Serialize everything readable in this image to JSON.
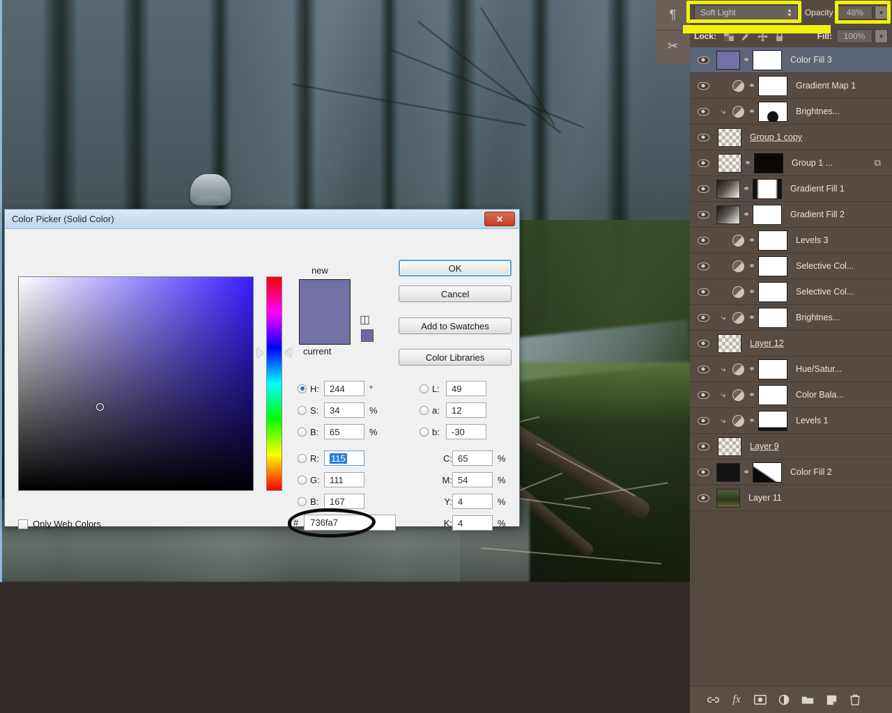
{
  "app": {
    "canvas_alt": "Misty forest scene with light shafts and gravel path"
  },
  "layers_panel": {
    "blend_mode": "Soft Light",
    "opacity_label": "Opacity",
    "opacity_value": "48%",
    "lock_label": "Lock:",
    "fill_label": "Fill:",
    "fill_value": "100%",
    "lock_icons": [
      "transparency-lock-icon",
      "paint-lock-icon",
      "move-lock-icon",
      "all-lock-icon"
    ],
    "strip_icons": [
      "paragraph-panel-icon",
      "tools-panel-icon"
    ],
    "bottom_icons": [
      "link-layers-icon",
      "layer-style-fx-icon",
      "add-mask-icon",
      "adjustment-layer-icon",
      "new-group-icon",
      "new-layer-icon",
      "delete-layer-icon"
    ],
    "bottom_labels": [
      "⚭",
      "fx",
      "▣",
      "◑",
      "▰",
      "⧉",
      "Ὕ1"
    ],
    "layers": [
      {
        "name": "Color Fill 3",
        "type": "fill",
        "selected": true,
        "clipped": false,
        "linked": true,
        "thumb": "solid-purple",
        "mask": "white",
        "badge": ""
      },
      {
        "name": "Gradient Map 1",
        "type": "adjustment",
        "selected": false,
        "clipped": false,
        "linked": true,
        "thumb": "adjustment",
        "mask": "white",
        "badge": ""
      },
      {
        "name": "Brightnes...",
        "type": "adjustment",
        "selected": false,
        "clipped": true,
        "linked": true,
        "thumb": "adjustment",
        "mask": "shape",
        "badge": ""
      },
      {
        "name": "Group 1 copy",
        "type": "pixel",
        "selected": false,
        "clipped": false,
        "linked": false,
        "thumb": "transparent",
        "mask": "none",
        "badge": "",
        "underline": true
      },
      {
        "name": "Group 1 ...",
        "type": "pixel",
        "selected": false,
        "clipped": false,
        "linked": true,
        "thumb": "transparent",
        "mask": "black",
        "badge": "smart-object-icon"
      },
      {
        "name": "Gradient Fill 1",
        "type": "fill",
        "selected": false,
        "clipped": false,
        "linked": true,
        "thumb": "gradient",
        "mask": "trapezoid",
        "badge": ""
      },
      {
        "name": "Gradient Fill 2",
        "type": "fill",
        "selected": false,
        "clipped": false,
        "linked": true,
        "thumb": "gradient",
        "mask": "white",
        "badge": ""
      },
      {
        "name": "Levels 3",
        "type": "adjustment",
        "selected": false,
        "clipped": false,
        "linked": true,
        "thumb": "adjustment",
        "mask": "white",
        "badge": ""
      },
      {
        "name": "Selective Col...",
        "type": "adjustment",
        "selected": false,
        "clipped": false,
        "linked": true,
        "thumb": "adjustment",
        "mask": "white",
        "badge": ""
      },
      {
        "name": "Selective Col...",
        "type": "adjustment",
        "selected": false,
        "clipped": false,
        "linked": true,
        "thumb": "adjustment",
        "mask": "white",
        "badge": ""
      },
      {
        "name": "Brightnes...",
        "type": "adjustment",
        "selected": false,
        "clipped": true,
        "linked": true,
        "thumb": "adjustment",
        "mask": "white",
        "badge": ""
      },
      {
        "name": "Layer 12",
        "type": "pixel",
        "selected": false,
        "clipped": false,
        "linked": false,
        "thumb": "transparent",
        "mask": "none",
        "badge": "",
        "underline": true
      },
      {
        "name": "Hue/Satur...",
        "type": "adjustment",
        "selected": false,
        "clipped": true,
        "linked": true,
        "thumb": "adjustment",
        "mask": "white",
        "badge": ""
      },
      {
        "name": "Color Bala...",
        "type": "adjustment",
        "selected": false,
        "clipped": true,
        "linked": true,
        "thumb": "adjustment",
        "mask": "white",
        "badge": ""
      },
      {
        "name": "Levels 1",
        "type": "adjustment",
        "selected": false,
        "clipped": true,
        "linked": true,
        "thumb": "adjustment",
        "mask": "white-dark-bottom",
        "badge": ""
      },
      {
        "name": "Layer 9",
        "type": "pixel",
        "selected": false,
        "clipped": false,
        "linked": false,
        "thumb": "transparent",
        "mask": "none",
        "badge": "",
        "underline": true
      },
      {
        "name": "Color Fill 2",
        "type": "fill",
        "selected": false,
        "clipped": false,
        "linked": true,
        "thumb": "solid-black",
        "mask": "curve",
        "badge": ""
      },
      {
        "name": "Layer 11",
        "type": "pixel",
        "selected": false,
        "clipped": false,
        "linked": false,
        "thumb": "photo",
        "mask": "none",
        "badge": ""
      }
    ]
  },
  "color_picker": {
    "title": "Color Picker (Solid Color)",
    "close_label": "✕",
    "new_label": "new",
    "current_label": "current",
    "new_color": "#736fa7",
    "current_color": "#736fa7",
    "buttons": {
      "ok": "OK",
      "cancel": "Cancel",
      "add_to_swatches": "Add to Swatches",
      "color_libraries": "Color Libraries"
    },
    "only_web_colors": "Only Web Colors",
    "hex_hash": "#",
    "hex_value": "736fa7",
    "hsb": [
      {
        "radio": "H",
        "label": "H:",
        "value": "244",
        "unit": "°",
        "selected": true
      },
      {
        "radio": "S",
        "label": "S:",
        "value": "34",
        "unit": "%",
        "selected": false
      },
      {
        "radio": "B",
        "label": "B:",
        "value": "65",
        "unit": "%",
        "selected": false
      }
    ],
    "rgb": [
      {
        "radio": "R",
        "label": "R:",
        "value": "115",
        "unit": "",
        "selected": false,
        "focused": true
      },
      {
        "radio": "G",
        "label": "G:",
        "value": "111",
        "unit": "",
        "selected": false,
        "focused": false
      },
      {
        "radio": "B",
        "label": "B:",
        "value": "167",
        "unit": "",
        "selected": false,
        "focused": false
      }
    ],
    "lab": [
      {
        "radio": "L",
        "label": "L:",
        "value": "49",
        "unit": "",
        "selected": false
      },
      {
        "radio": "a",
        "label": "a:",
        "value": "12",
        "unit": "",
        "selected": false
      },
      {
        "radio": "b",
        "label": "b:",
        "value": "-30",
        "unit": "",
        "selected": false
      }
    ],
    "cmyk": [
      {
        "label": "C:",
        "value": "65",
        "unit": "%"
      },
      {
        "label": "M:",
        "value": "54",
        "unit": "%"
      },
      {
        "label": "Y:",
        "value": "4",
        "unit": "%"
      },
      {
        "label": "K:",
        "value": "4",
        "unit": "%"
      }
    ]
  },
  "annotations": {
    "highlight_color": "#f2f208",
    "circle_color": "#0b0b0b"
  }
}
